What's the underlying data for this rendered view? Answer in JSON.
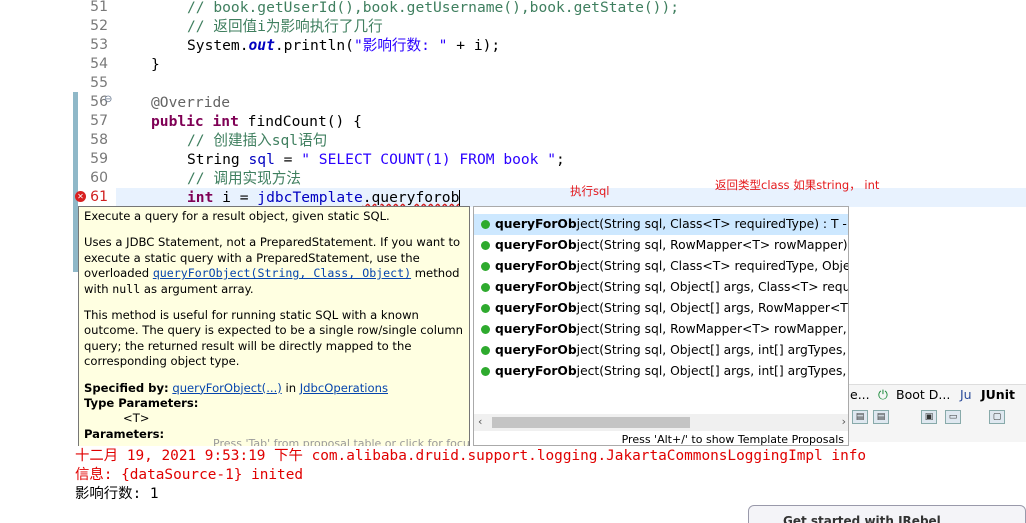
{
  "editor": {
    "line_numbers": [
      "51",
      "52",
      "53",
      "54",
      "55",
      "56",
      "57",
      "58",
      "59",
      "60",
      "61"
    ],
    "lines": {
      "l51": "// book.getUserId(),book.getUsername(),book.getState());",
      "l52": "// 返回值i为影响执行了几行",
      "l53_a": "System.",
      "l53_b": "out",
      "l53_c": ".println(",
      "l53_d": "\"影响行数: \"",
      "l53_e": " + i);",
      "l54": "}",
      "l56": "@Override",
      "l57_kw1": "public",
      "l57_kw2": "int",
      "l57_rest": " findCount() {",
      "l58": "// 创建插入sql语句",
      "l59_a": "String ",
      "l59_b": "sql",
      "l59_c": " = ",
      "l59_d": "\" SELECT COUNT(1) FROM book \"",
      "l59_e": ";",
      "l60": "// 调用实现方法",
      "l61_kw": "int",
      "l61_a": " i = ",
      "l61_b": "jdbcTemplate",
      "l61_c": ".queryforob"
    },
    "annotations": {
      "exec_sql": "执行sql",
      "return_type": "返回类型class 如果string， int"
    },
    "override_marker": "⊖"
  },
  "doc_popup": {
    "p1": "Execute a query for a result object, given static SQL.",
    "p2_a": "Uses a JDBC Statement, not a PreparedStatement. If you want to execute a static query with a PreparedStatement, use the overloaded ",
    "p2_link": "queryForObject(String, Class, Object)",
    "p2_b": " method with ",
    "p2_code": "null",
    "p2_c": " as argument array.",
    "p3": "This method is useful for running static SQL with a known outcome. The query is expected to be a single row/single column query; the returned result will be directly mapped to the corresponding object type.",
    "specified_by_label": "Specified by:",
    "specified_by_link1": "queryForObject(...)",
    "specified_by_in": " in ",
    "specified_by_link2": "JdbcOperations",
    "type_params_label": "Type Parameters:",
    "type_param": "<T>",
    "params_label": "Parameters:",
    "hint": "Press 'Tab' from proposal table or click for focus"
  },
  "proposals": {
    "items": [
      {
        "bold": "queryForOb",
        "rest": "ject(String sql, Class<T> requiredType) : T - Jdbc"
      },
      {
        "bold": "queryForOb",
        "rest": "ject(String sql, RowMapper<T> rowMapper) : T"
      },
      {
        "bold": "queryForOb",
        "rest": "ject(String sql, Class<T> requiredType, Object..."
      },
      {
        "bold": "queryForOb",
        "rest": "ject(String sql, Object[] args, Class<T> required"
      },
      {
        "bold": "queryForOb",
        "rest": "ject(String sql, Object[] args, RowMapper<T> ro"
      },
      {
        "bold": "queryForOb",
        "rest": "ject(String sql, RowMapper<T> rowMapper, Ob"
      },
      {
        "bold": "queryForOb",
        "rest": "ject(String sql, Object[] args, int[] argTypes, Clas"
      },
      {
        "bold": "queryForOb",
        "rest": "ject(String sql, Object[] args, int[] argTypes, Row"
      }
    ],
    "footer": "Press 'Alt+/' to show Template Proposals",
    "scroll_left": "‹",
    "scroll_right": "›"
  },
  "views": {
    "tab_partial": "e...",
    "boot_tab": "Boot D...",
    "junit_tab": "JUnit"
  },
  "console": {
    "line1": "十二月 19, 2021 9:53:19 下午 com.alibaba.druid.support.logging.JakartaCommonsLoggingImpl info",
    "line2": "信息: {dataSource-1} inited",
    "line3": "影响行数: 1"
  },
  "junit_popup": {
    "text": "Get started with JRebel"
  }
}
